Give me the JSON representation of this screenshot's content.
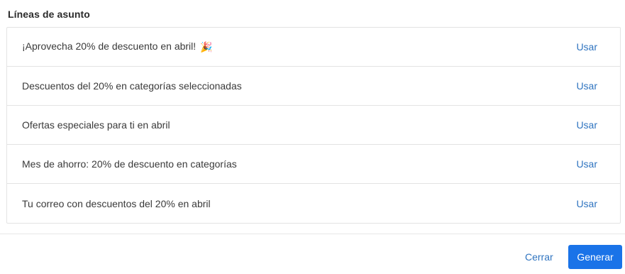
{
  "panel": {
    "title": "Líneas de asunto"
  },
  "subject_lines": [
    {
      "text": "¡Aprovecha 20% de descuento en abril!",
      "emoji": "🎉",
      "action": "Usar"
    },
    {
      "text": "Descuentos del 20% en categorías seleccionadas",
      "action": "Usar"
    },
    {
      "text": "Ofertas especiales para ti en abril",
      "action": "Usar"
    },
    {
      "text": "Mes de ahorro: 20% de descuento en categorías",
      "action": "Usar"
    },
    {
      "text": "Tu correo con descuentos del 20% en abril",
      "action": "Usar"
    }
  ],
  "footer": {
    "close_label": "Cerrar",
    "generate_label": "Generar"
  },
  "colors": {
    "link": "#2f74c0",
    "primary_button": "#1a73e8",
    "border": "#e3e3e3"
  }
}
